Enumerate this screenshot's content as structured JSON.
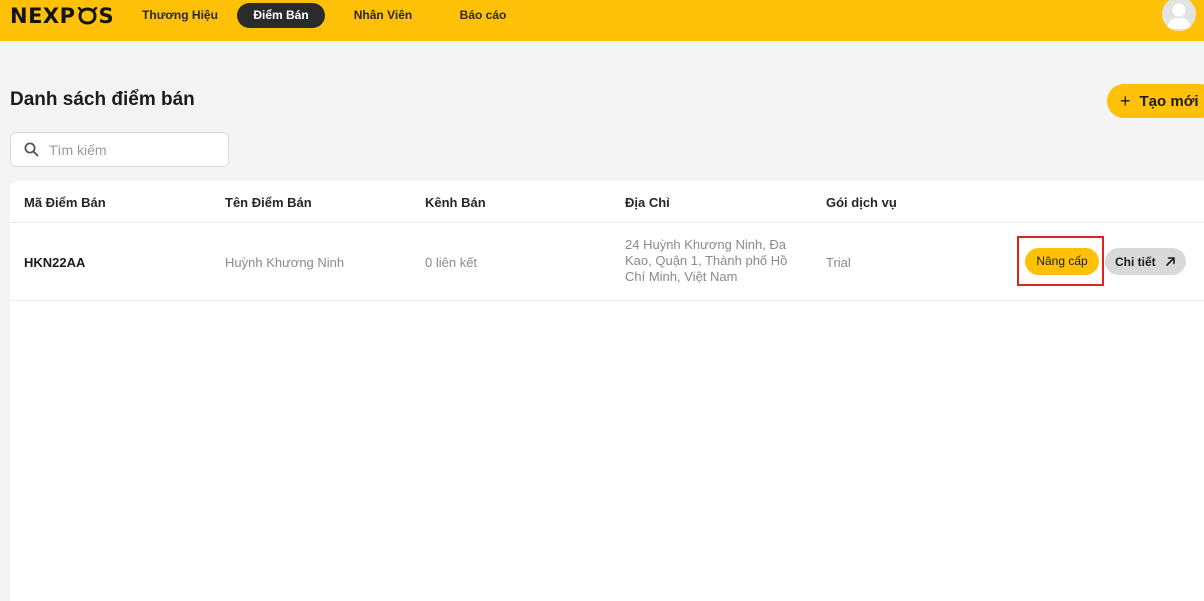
{
  "header": {
    "logo_left": "NEXP",
    "logo_right": "S",
    "nav": [
      {
        "label": "Thương Hiệu",
        "active": false
      },
      {
        "label": "Điểm Bán",
        "active": true
      },
      {
        "label": "Nhân Viên",
        "active": false
      },
      {
        "label": "Báo cáo",
        "active": false
      }
    ],
    "avatar_icon": "user-avatar-icon"
  },
  "page": {
    "title": "Danh sách điểm bán",
    "create_label": "Tạo mới",
    "search_placeholder": "Tìm kiếm"
  },
  "table": {
    "columns": [
      "Mã Điểm Bán",
      "Tên Điểm Bán",
      "Kênh Bán",
      "Địa Chỉ",
      "Gói dịch vụ"
    ],
    "rows": [
      {
        "code": "HKN22AA",
        "name": "Huỳnh Khương Ninh",
        "channels": "0 liên kết",
        "address": "24 Huỳnh Khương Ninh, Đa Kao, Quận 1, Thành phố Hồ Chí Minh, Việt Nam",
        "plan": "Trial",
        "upgrade_label": "Nâng cấp",
        "detail_label": "Chi tiết"
      }
    ]
  },
  "colors": {
    "brand": "#ffc107",
    "dark": "#2b2b2b",
    "highlight": "#e2231a"
  }
}
